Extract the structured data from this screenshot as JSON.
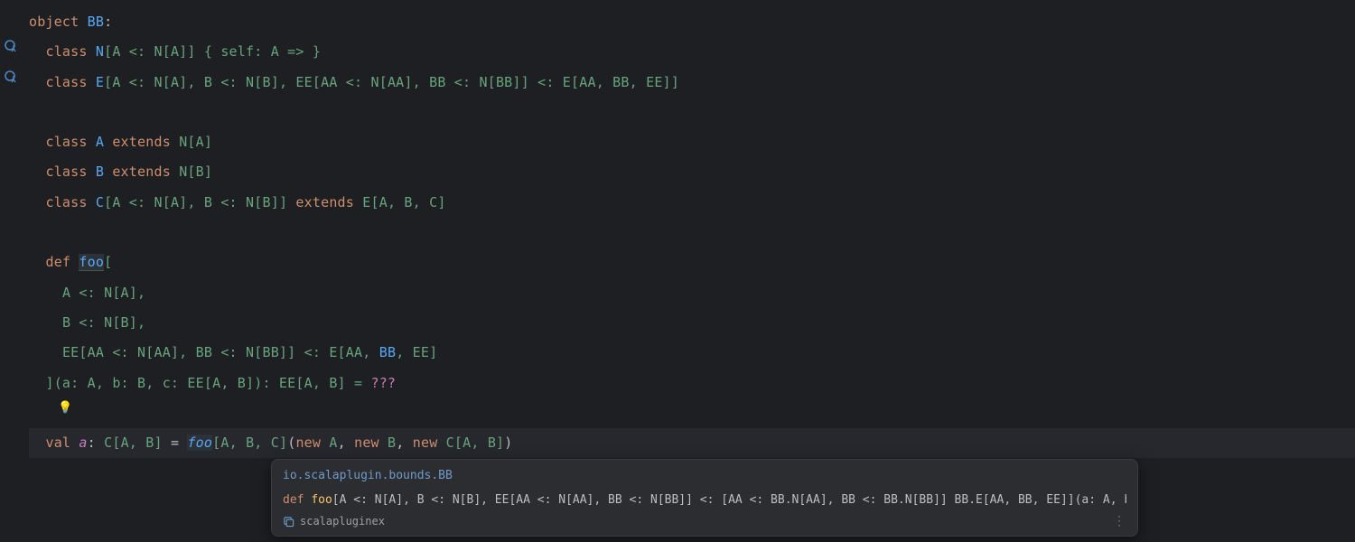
{
  "code": {
    "l1": {
      "kw_object": "object",
      "name": "BB",
      "colon": ":"
    },
    "l2": {
      "kw_class": "class",
      "name": "N",
      "tparams": "[A <: N[A]] { self: A => }"
    },
    "l3": {
      "kw_class": "class",
      "name": "E",
      "tparams": "[A <: N[A], B <: N[B], EE[AA <: N[AA], BB <: N[BB]] <: E[AA, BB, EE]]"
    },
    "l5": {
      "kw_class": "class",
      "name": "A",
      "kw_extends": "extends",
      "sup": "N[A]"
    },
    "l6": {
      "kw_class": "class",
      "name": "B",
      "kw_extends": "extends",
      "sup": "N[B]"
    },
    "l7": {
      "kw_class": "class",
      "name": "C",
      "tparams": "[A <: N[A], B <: N[B]]",
      "kw_extends": "extends",
      "sup": "E[A, B, C]"
    },
    "l9": {
      "kw_def": "def",
      "name": "foo",
      "open": "["
    },
    "l10": "A <: N[A],",
    "l11": "B <: N[B],",
    "l12_a": "EE[AA <: N[AA], BB <: N[BB]] <: E[AA, ",
    "l12_bb": "BB",
    "l12_b": ", EE]",
    "l13_a": "](a: A, b: B, c: EE[A, B]): EE[A, B] = ",
    "l13_q": "???",
    "l15": {
      "kw_val": "val",
      "name": "a",
      "colon": ":",
      "type": "C[A, B]",
      "eq": "=",
      "call": "foo",
      "targs": "[A, B, C]",
      "paren": "(",
      "kw_new1": "new",
      "arg1": "A",
      "c1": ",",
      "kw_new2": "new",
      "arg2": "B",
      "c2": ",",
      "kw_new3": "new",
      "arg3": "C[A, B]",
      "close": ")"
    }
  },
  "popup": {
    "pkg": "io.scalaplugin.bounds.BB",
    "sig_kw": "def ",
    "sig_name": "foo",
    "sig_rest": "[A <: N[A], B <: N[B], EE[AA <: N[AA], BB <: N[BB]] <: [AA <: BB.N[AA], BB <: BB.N[BB]] BB.E[AA, BB, EE]](a: A, b",
    "module": "scalapluginex"
  },
  "icons": {
    "implements": "implements",
    "bulb": "bulb"
  }
}
